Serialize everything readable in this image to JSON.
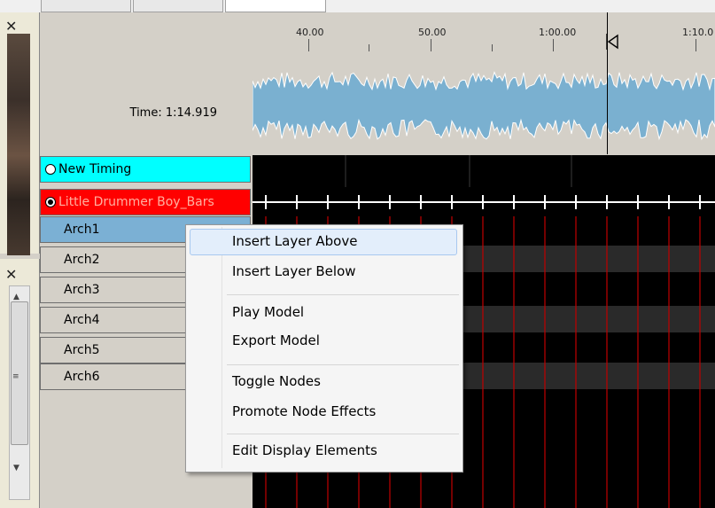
{
  "window": {
    "tabs": [
      "",
      "",
      ""
    ]
  },
  "time_display": "Time: 1:14.919",
  "ruler": {
    "ticks": [
      "40.00",
      "50.00",
      "1:00.00",
      "1:10.0"
    ]
  },
  "rows": [
    {
      "label": "New Timing",
      "type": "timing",
      "color": "#00ffff"
    },
    {
      "label": "Little Drummer Boy_Bars",
      "type": "timing",
      "color": "#ff0000"
    },
    {
      "label": "Arch1",
      "type": "model",
      "selected": true
    },
    {
      "label": "Arch2",
      "type": "model"
    },
    {
      "label": "Arch3",
      "type": "model"
    },
    {
      "label": "Arch4",
      "type": "model"
    },
    {
      "label": "Arch5",
      "type": "model"
    },
    {
      "label": "Arch6",
      "type": "model"
    }
  ],
  "context_menu": {
    "items": [
      {
        "label": "Insert Layer Above",
        "highlighted": true
      },
      {
        "label": "Insert Layer Below"
      },
      {
        "label": "Play Model"
      },
      {
        "label": "Export Model"
      },
      {
        "label": "Toggle Nodes"
      },
      {
        "label": "Promote Node Effects"
      },
      {
        "label": "Edit Display Elements"
      }
    ]
  },
  "colors": {
    "waveform": "#7ab0d0",
    "grid_line": "#c00000",
    "selection": "#7bb0d4"
  },
  "icons": {
    "close": "close-icon",
    "play_marker": "play-marker-icon"
  }
}
